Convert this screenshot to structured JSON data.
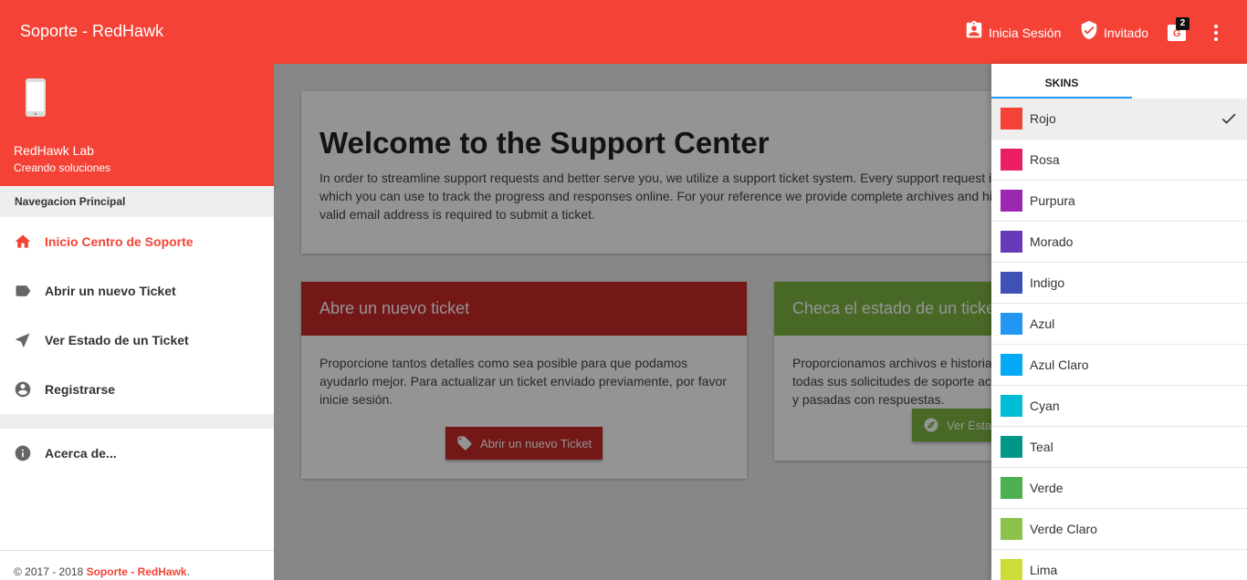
{
  "topbar": {
    "brand": "Soporte - RedHawk",
    "login_label": "Inicia Sesión",
    "guest_label": "Invitado",
    "lang_badge": "2"
  },
  "sidebar": {
    "org_name": "RedHawk Lab",
    "org_tagline": "Creando soluciones",
    "section_title": "Navegacion Principal",
    "items": [
      {
        "label": "Inicio Centro de Soporte",
        "icon": "home-icon",
        "active": true
      },
      {
        "label": "Abrir un nuevo Ticket",
        "icon": "label-icon"
      },
      {
        "label": "Ver Estado de un Ticket",
        "icon": "navigation-icon"
      },
      {
        "label": "Registrarse",
        "icon": "account-circle-icon"
      }
    ],
    "about_label": "Acerca de...",
    "footer_prefix": "© 2017 - 2018 ",
    "footer_link": "Soporte - RedHawk",
    "footer_suffix": "."
  },
  "main": {
    "welcome_title": "Welcome to the Support Center",
    "welcome_line1": "In order to streamline support requests and better serve you, we utilize a support ticket system. Every support request is assigned a unique ticket number",
    "welcome_line2": "which you can use to track the progress and responses online. For your reference we provide complete archives and history of all your support requests. A",
    "welcome_line3": "valid email address is required to submit a ticket.",
    "card_new": {
      "title": "Abre un nuevo ticket",
      "body": "Proporcione tantos detalles como sea posible para que podamos ayudarlo mejor. Para actualizar un ticket enviado previamente, por favor inicie sesión.",
      "button": "Abrir un nuevo Ticket",
      "color": "#c62828"
    },
    "card_status": {
      "title": "Checa el estado de un ticket",
      "body": "Proporcionamos archivos e historial de todas sus solicitudes de soporte actuales y pasadas con respuestas.",
      "button": "Ver Estado de un Ticket",
      "color": "#7cb342"
    }
  },
  "skins": {
    "tab_label": "SKINS",
    "items": [
      {
        "label": "Rojo",
        "color": "#f44336",
        "selected": true
      },
      {
        "label": "Rosa",
        "color": "#e91e63"
      },
      {
        "label": "Purpura",
        "color": "#9c27b0"
      },
      {
        "label": "Morado",
        "color": "#673ab7"
      },
      {
        "label": "Indigo",
        "color": "#3f51b5"
      },
      {
        "label": "Azul",
        "color": "#2196f3"
      },
      {
        "label": "Azul Claro",
        "color": "#03a9f4"
      },
      {
        "label": "Cyan",
        "color": "#00bcd4"
      },
      {
        "label": "Teal",
        "color": "#009688"
      },
      {
        "label": "Verde",
        "color": "#4caf50"
      },
      {
        "label": "Verde Claro",
        "color": "#8bc34a"
      },
      {
        "label": "Lima",
        "color": "#cddc39"
      }
    ]
  }
}
